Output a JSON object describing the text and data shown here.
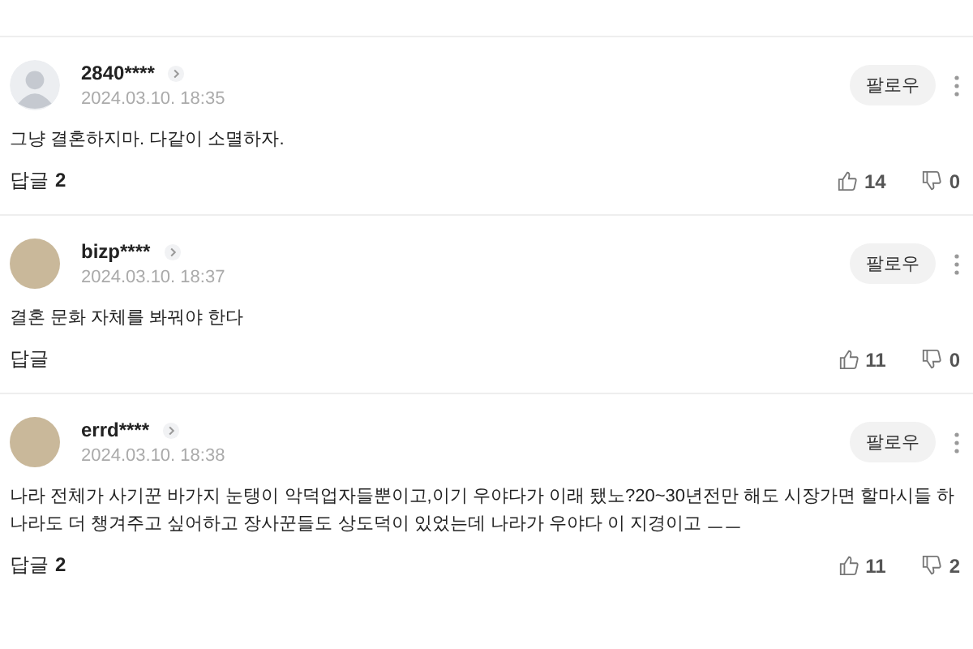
{
  "comments": [
    {
      "user": "2840****",
      "date": "2024.03.10. 18:35",
      "kind": "default",
      "follow": "팔로우",
      "text": "그냥 결혼하지마. 다같이 소멸하자.",
      "reply_label": "답글",
      "reply_count": "2",
      "likes": "14",
      "dislikes": "0"
    },
    {
      "user": "bizp****",
      "date": "2024.03.10. 18:37",
      "kind": "photo",
      "follow": "팔로우",
      "text": "결혼 문화 자체를 봐꿔야 한다",
      "reply_label": "답글",
      "likes": "11",
      "dislikes": "0"
    },
    {
      "user": "errd****",
      "date": "2024.03.10. 18:38",
      "kind": "photo",
      "follow": "팔로우",
      "text": "나라 전체가 사기꾼 바가지 눈탱이 악덕업자들뿐이고,이기 우야다가 이래 됐노?20~30년전만 해도 시장가면 할마시들 하나라도 더 챙겨주고 싶어하고 장사꾼들도 상도덕이 있었는데 나라가 우야다 이 지경이고 ㅡㅡ",
      "reply_label": "답글",
      "reply_count": "2",
      "likes": "11",
      "dislikes": "2"
    }
  ]
}
